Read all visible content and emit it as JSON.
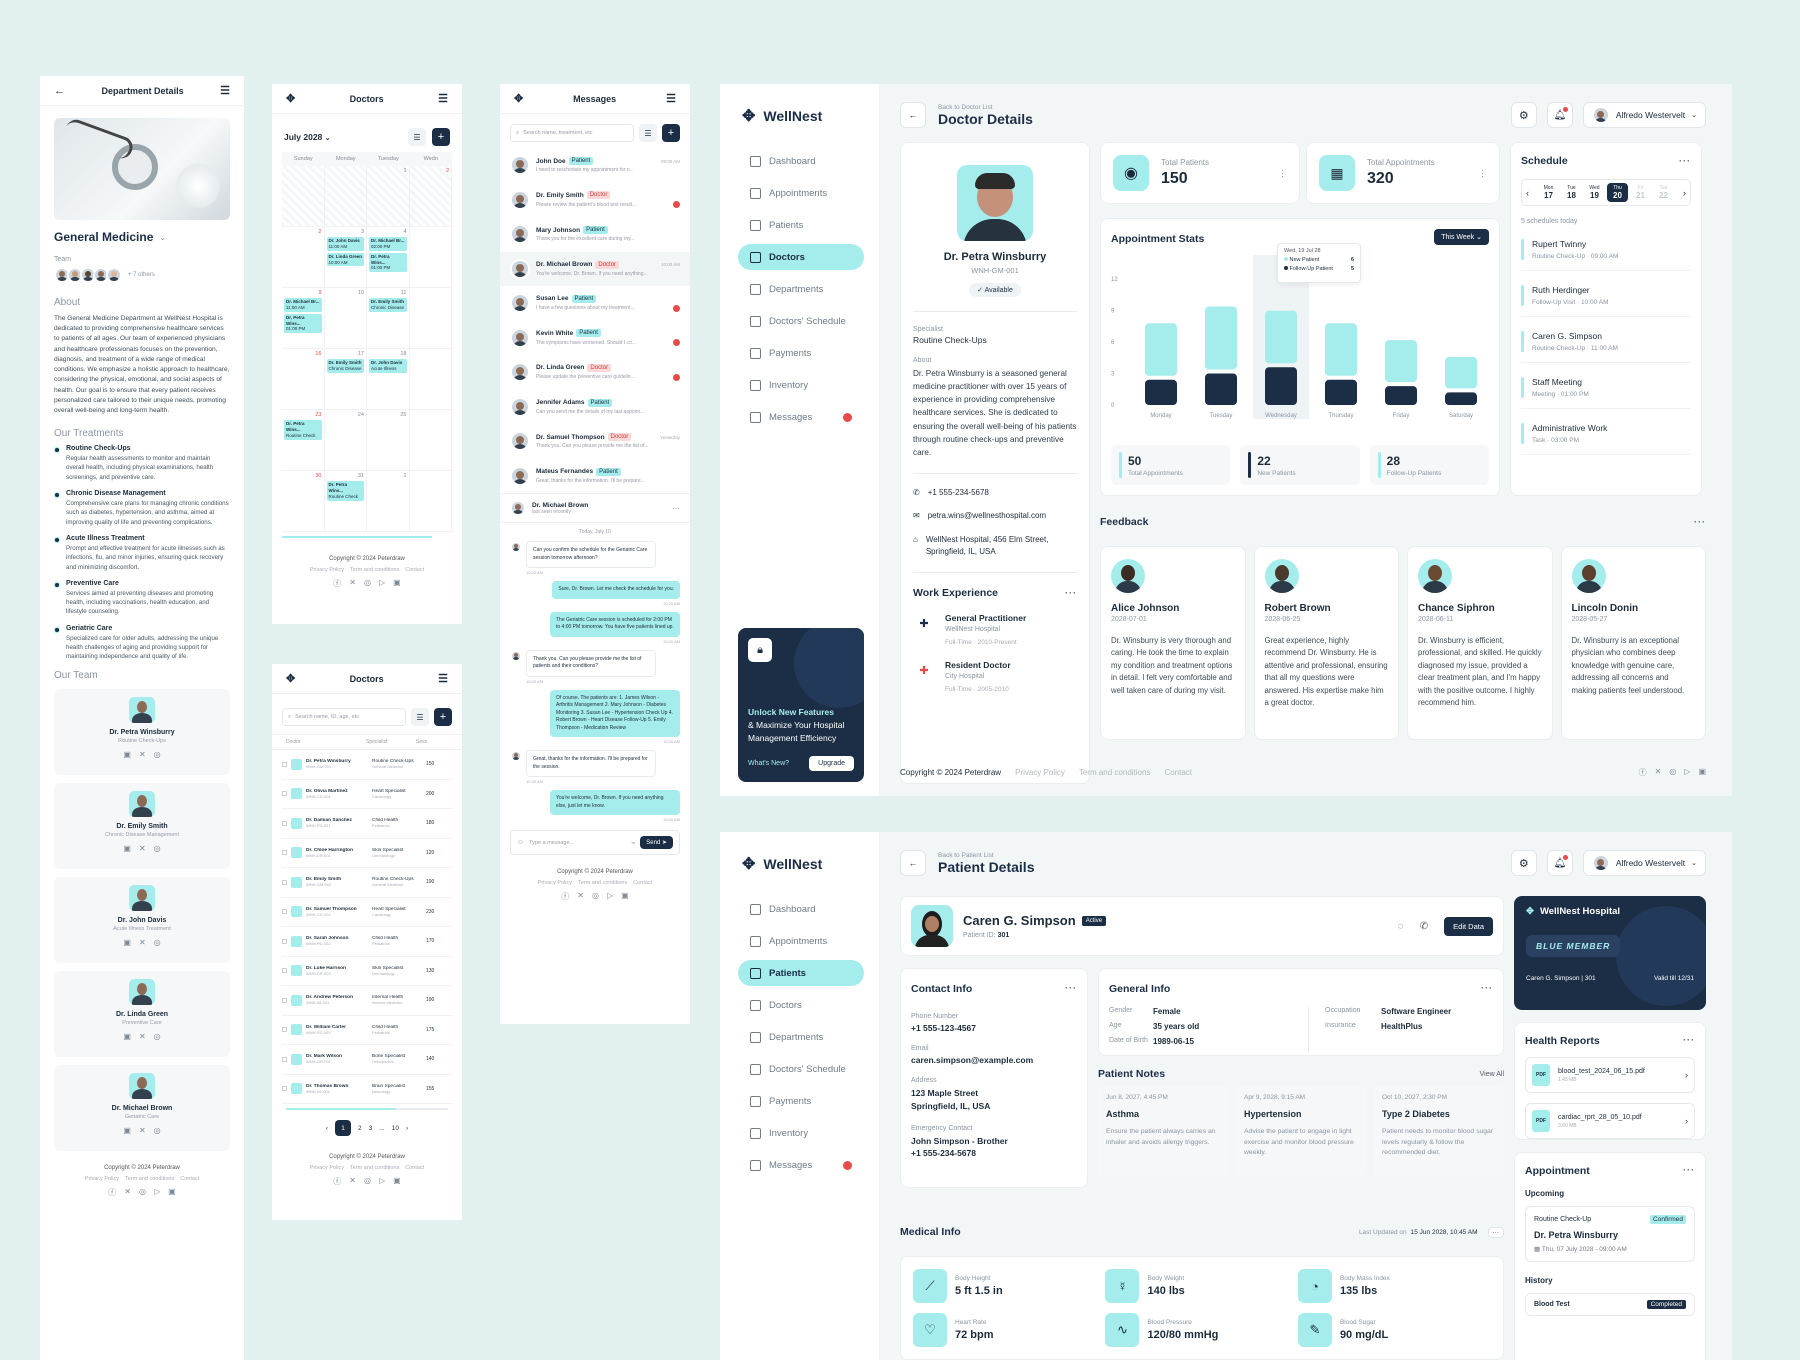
{
  "mob1": {
    "title": "Department Details",
    "dept": "General Medicine",
    "team_label": "Team",
    "team_more": "+ 7 others",
    "about_h": "About",
    "about": "The General Medicine Department at WellNest Hospital is dedicated to providing comprehensive healthcare services to patients of all ages. Our team of experienced physicians and healthcare professionals focuses on the prevention, diagnosis, and treatment of a wide range of medical conditions. We emphasize a holistic approach to healthcare, considering the physical, emotional, and social aspects of health. Our goal is to ensure that every patient receives personalized care tailored to their unique needs, promoting overall well-being and long-term health.",
    "treat_h": "Our Treatments",
    "treatments": [
      {
        "t": "Routine Check-Ups",
        "d": "Regular health assessments to monitor and maintain overall health, including physical examinations, health screenings, and preventive care."
      },
      {
        "t": "Chronic Disease Management",
        "d": "Comprehensive care plans for managing chronic conditions such as diabetes, hypertension, and asthma, aimed at improving quality of life and preventing complications."
      },
      {
        "t": "Acute Illness Treatment",
        "d": "Prompt and effective treatment for acute illnesses such as infections, flu, and minor injuries, ensuring quick recovery and minimizing discomfort."
      },
      {
        "t": "Preventive Care",
        "d": "Services aimed at preventing diseases and promoting health, including vaccinations, health education, and lifestyle counseling."
      },
      {
        "t": "Geriatric Care",
        "d": "Specialized care for older adults, addressing the unique health challenges of aging and providing support for maintaining independence and quality of life."
      }
    ],
    "team_h": "Our Team",
    "team": [
      {
        "n": "Dr. Petra Winsburry",
        "r": "Routine Check-Ups"
      },
      {
        "n": "Dr. Emily Smith",
        "r": "Chronic Disease Management"
      },
      {
        "n": "Dr. John Davis",
        "r": "Acute Illness Treatment"
      },
      {
        "n": "Dr. Linda Green",
        "r": "Preventive Care"
      },
      {
        "n": "Dr. Michael Brown",
        "r": "Geriatric Care"
      }
    ],
    "copyright": "Copyright © 2024 Peterdraw",
    "links": [
      "Privacy Policy",
      "Term and conditions",
      "Contact"
    ]
  },
  "mob2": {
    "title": "Doctors",
    "month": "July 2028",
    "days": [
      "Sunday",
      "Monday",
      "Tuesday",
      "Wedn"
    ],
    "weeks": [
      [
        "",
        "",
        " 1",
        "2"
      ],
      [
        "2",
        "3",
        "4",
        ""
      ],
      [
        "9",
        "10",
        "11",
        ""
      ],
      [
        "16",
        "17",
        "18",
        ""
      ],
      [
        "23",
        "24",
        "25",
        ""
      ],
      [
        "30",
        "31",
        "1",
        ""
      ]
    ],
    "events": [
      {
        "t": "Dr. John Davis",
        "s": "11:00 AM"
      },
      {
        "t": "Dr. Michael Br...",
        "s": "02:00 PM"
      },
      {
        "t": "Dr. Linda Green",
        "s": "10:00 AM"
      },
      {
        "t": "Dr. Petra Wins...",
        "s": "01:00 PM"
      },
      {
        "t": "Dr. Michael Br...",
        "s": "11:00 AM"
      },
      {
        "t": "Dr. Emily Smith",
        "s": "Chronic Disease"
      },
      {
        "t": "Dr. Emily Smith",
        "s": "Chronic Disease"
      },
      {
        "t": "Dr. John Davis",
        "s": "Acute Illness"
      },
      {
        "t": "Dr. Petra Wins...",
        "s": "Routine Check"
      },
      {
        "t": "Dr. Petra Wins...",
        "s": "Routine Check"
      }
    ],
    "copyright": "Copyright © 2024 Peterdraw",
    "links": [
      "Privacy Policy",
      "Term and conditions",
      "Contact"
    ]
  },
  "mob3": {
    "title": "Doctors",
    "search": "Search name, ID, age, etc",
    "cols": [
      "Doctor",
      "Specialist",
      "Sess"
    ],
    "rows": [
      [
        "Dr. Petra Winsburry",
        "WNH-GM-001",
        "Routine Check-Ups",
        "General Medicine",
        "150"
      ],
      [
        "Dr. Olivia Martinez",
        "WNH-CD-001",
        "Heart Specialist",
        "Cardiology",
        "200"
      ],
      [
        "Dr. Damian Sanchez",
        "WNH-PD-001",
        "Child Health",
        "Pediatrics",
        "180"
      ],
      [
        "Dr. Chloe Harrington",
        "WNH-DR-001",
        "Skin Specialist",
        "Dermatology",
        "120"
      ],
      [
        "Dr. Emily Smith",
        "WNH-GM-002",
        "Routine Check-Ups",
        "General Medicine",
        "190"
      ],
      [
        "Dr. Samuel Thompson",
        "WNH-CD-002",
        "Heart Specialist",
        "Cardiology",
        "230"
      ],
      [
        "Dr. Sarah Johnson",
        "WNH-PD-002",
        "Child Health",
        "Pediatrics",
        "170"
      ],
      [
        "Dr. Luke Harrison",
        "WNH-DR-002",
        "Skin Specialist",
        "Dermatology",
        "130"
      ],
      [
        "Dr. Andrew Peterson",
        "WNH-IM-001",
        "Internal Health",
        "Internal Medicine",
        "190"
      ],
      [
        "Dr. William Carter",
        "WNH-PD-003",
        "Child Health",
        "Pediatrics",
        "175"
      ],
      [
        "Dr. Mark Wilson",
        "WNH-OR-001",
        "Bone Specialist",
        "Orthopedics",
        "140"
      ],
      [
        "Dr. Thomas Brown",
        "WNH-NL-001",
        "Brain Specialist",
        "Neurology",
        "155"
      ]
    ],
    "pages": [
      "1",
      "2",
      "3",
      "...",
      "10"
    ],
    "copyright": "Copyright © 2024 Peterdraw",
    "links": [
      "Privacy Policy",
      "Term and conditions",
      "Contact"
    ]
  },
  "mob4": {
    "title": "Messages",
    "search": "Search name, treatment, etc",
    "threads": [
      {
        "n": "John Doe",
        "tag": "Patient",
        "m": "I need to reschedule my appointment for n...",
        "time": "09:00 AM",
        "red": false
      },
      {
        "n": "Dr. Emily Smith",
        "tag": "Doctor",
        "m": "Please review the patient's blood test result...",
        "time": "",
        "red": true
      },
      {
        "n": "Mary Johnson",
        "tag": "Patient",
        "m": "Thank you for the excellent care during my...",
        "time": "",
        "red": false
      },
      {
        "n": "Dr. Michael Brown",
        "tag": "Doctor",
        "m": "You're welcome, Dr. Brown. If you need anything...",
        "time": "10:00 AM",
        "red": false
      },
      {
        "n": "Susan Lee",
        "tag": "Patient",
        "m": "I have a few questions about my treatment...",
        "time": "",
        "red": true
      },
      {
        "n": "Kevin White",
        "tag": "Patient",
        "m": "The symptoms have worsened. Should I co...",
        "time": "",
        "red": true
      },
      {
        "n": "Dr. Linda Green",
        "tag": "Doctor",
        "m": "Please update the preventive care guidelin...",
        "time": "",
        "red": true
      },
      {
        "n": "Jennifer Adams",
        "tag": "Patient",
        "m": "Can you send me the details of my last appoint...",
        "time": "",
        "red": false
      },
      {
        "n": "Dr. Samuel Thompson",
        "tag": "Doctor",
        "m": "Thank you. Can you please provide me the list of...",
        "time": "Yesterday",
        "red": false
      },
      {
        "n": "Mateus Fernandes",
        "tag": "Patient",
        "m": "Great, thanks for the information. I'll be prepare...",
        "time": "",
        "red": false
      }
    ],
    "chat_name": "Dr. Michael Brown",
    "chat_status": "last seen recently",
    "day": "Today, July 10",
    "msgs": [
      {
        "me": false,
        "t": "Can you confirm the schedule for the Geriatric Care session tomorrow afternoon?",
        "time": "10:00 AM"
      },
      {
        "me": true,
        "t": "Sure, Dr. Brown. Let me check the schedule for you.",
        "time": "10:20 AM"
      },
      {
        "me": true,
        "t": "The Geriatric Care session is scheduled for 2:00 PM to 4:00 PM tomorrow. You have five patients lined up.",
        "time": "10:20 AM"
      },
      {
        "me": false,
        "t": "Thank you. Can you please provide me the list of patients and their conditions?",
        "time": "10:25 AM"
      },
      {
        "me": true,
        "t": "Of course. The patients are: 1. James Wilson - Arthritis Management 2. Mary Johnson - Diabetes Monitoring 3. Susan Lee - Hypertension Check Up 4. Robert Brown - Heart Disease Follow-Up 5. Emily Thompson - Medication Review",
        "time": "10:30 AM"
      },
      {
        "me": false,
        "t": "Great, thanks for the information. I'll be prepared for the session.",
        "time": "10:35 AM"
      },
      {
        "me": true,
        "t": "You're welcome, Dr. Brown. If you need anything else, just let me know.",
        "time": "10:40 AM"
      }
    ],
    "input": "Type a message...",
    "send": "Send",
    "copyright": "Copyright © 2024 Peterdraw",
    "links": [
      "Privacy Policy",
      "Term and conditions",
      "Contact"
    ]
  },
  "brand": "WellNest",
  "nav": [
    "Dashboard",
    "Appointments",
    "Patients",
    "Doctors",
    "Departments",
    "Doctors' Schedule",
    "Payments",
    "Inventory",
    "Messages"
  ],
  "user": "Alfredo Westervelt",
  "promo": {
    "l1": "Unlock New Features",
    "l2": "& Maximize Your Hospital Management Efficiency",
    "whats": "What's New?",
    "upgrade": "Upgrade"
  },
  "doc": {
    "back": "Back to Doctor List",
    "title": "Doctor Details",
    "name": "Dr. Petra Winsburry",
    "id": "WNH-GM-001",
    "status": "Available",
    "spec_l": "Specialist",
    "spec": "Routine Check-Ups",
    "about_l": "About",
    "about": "Dr. Petra Winsburry is a seasoned general medicine practitioner with over 15 years of experience in providing comprehensive healthcare services. She is dedicated to ensuring the overall well-being of his patients through routine check-ups and preventive care.",
    "phone": "+1 555-234-5678",
    "email": "petra.wins@wellnesthospital.com",
    "addr": "WellNest Hospital, 456 Elm Street, Springfield, IL, USA",
    "work_h": "Work Experience",
    "work": [
      {
        "t": "General Practitioner",
        "o": "WellNest Hospital",
        "p": "Full-Time",
        "y": "2010-Present"
      },
      {
        "t": "Resident Doctor",
        "o": "City Hospital",
        "p": "Full-Time",
        "y": "2005-2010"
      }
    ],
    "tp_l": "Total Patients",
    "tp": "150",
    "ta_l": "Total Appointments",
    "ta": "320",
    "stats_h": "Appointment Stats",
    "week": "This Week",
    "tip_d": "Wed, 19 Jul 28",
    "tip_np": "New Patient",
    "tip_np_v": "6",
    "tip_fu": "Follow-Up Patient",
    "tip_fu_v": "5",
    "sum": [
      {
        "v": "50",
        "l": "Total Appointments"
      },
      {
        "v": "22",
        "l": "New Patients"
      },
      {
        "v": "28",
        "l": "Follow-Up Patients"
      }
    ],
    "sched_h": "Schedule",
    "sched_days": [
      [
        "Mon",
        "17"
      ],
      [
        "Tue",
        "18"
      ],
      [
        "Wed",
        "19"
      ],
      [
        "Thu",
        "20"
      ],
      [
        "Fri",
        "21"
      ],
      [
        "Sat",
        "22"
      ]
    ],
    "sched_count": "5 schedules today",
    "sched": [
      {
        "n": "Rupert Twinny",
        "t": "Routine Check-Up",
        "h": "09:00 AM"
      },
      {
        "n": "Ruth Herdinger",
        "t": "Follow-Up Visit",
        "h": "10:00 AM"
      },
      {
        "n": "Caren G. Simpson",
        "t": "Routine Check-Up",
        "h": "11:00 AM"
      },
      {
        "n": "Staff Meeting",
        "t": "Meeting",
        "h": "01:00 PM"
      },
      {
        "n": "Administrative Work",
        "t": "Task",
        "h": "03:00 PM"
      }
    ],
    "fb_h": "Feedback",
    "fb": [
      {
        "n": "Alice Johnson",
        "d": "2028-07-01",
        "t": "Dr. Winsburry is very thorough and caring. He took the time to explain my condition and treatment options in detail. I felt very comfortable and well taken care of during my visit."
      },
      {
        "n": "Robert Brown",
        "d": "2028-06-25",
        "t": "Great experience, highly recommend Dr. Winsburry. He is attentive and professional, ensuring that all my questions were answered. His expertise make him a great doctor."
      },
      {
        "n": "Chance Siphron",
        "d": "2028-06-11",
        "t": "Dr. Winsburry is efficient, professional, and skilled. He quickly diagnosed my issue, provided a clear treatment plan, and I'm happy with the positive outcome. I highly recommend him."
      },
      {
        "n": "Lincoln Donin",
        "d": "2028-05-27",
        "t": "Dr. Winsburry is an exceptional physician who combines deep knowledge with genuine care, addressing all concerns and making patients feel understood."
      }
    ],
    "copyright": "Copyright © 2024 Peterdraw",
    "links": [
      "Privacy Policy",
      "Term and conditions",
      "Contact"
    ]
  },
  "chart_data": {
    "type": "bar",
    "categories": [
      "Monday",
      "Tuesday",
      "Wednesday",
      "Thursday",
      "Friday",
      "Saturday"
    ],
    "series": [
      {
        "name": "New Patient",
        "values": [
          4,
          5,
          6,
          4,
          3,
          2
        ]
      },
      {
        "name": "Follow-Up Patient",
        "values": [
          5,
          6,
          5,
          5,
          4,
          3
        ]
      }
    ],
    "ylim": [
      0,
      12
    ],
    "yticks": [
      "12",
      "9",
      "6",
      "3",
      "0"
    ],
    "stacked": true
  },
  "pat": {
    "back": "Back to Patient List",
    "title": "Patient Details",
    "name": "Caren G. Simpson",
    "status": "Active",
    "pid_l": "Patient ID:",
    "pid": "301",
    "edit": "Edit Data",
    "contact_h": "Contact Info",
    "phone_l": "Phone Number",
    "phone": "+1 555-123-4567",
    "email_l": "Email",
    "email": "caren.simpson@example.com",
    "addr_l": "Address",
    "addr1": "123 Maple Street",
    "addr2": "Springfield, IL, USA",
    "emerg_l": "Emergency Contact",
    "emerg1": "John Simpson - Brother",
    "emerg2": "+1 555-234-5678",
    "gen_h": "General Info",
    "gen": [
      [
        "Gender",
        "Female"
      ],
      [
        "Age",
        "35 years old"
      ],
      [
        "Date of Birth",
        "1989-06-15"
      ]
    ],
    "gen2": [
      [
        "Occupation",
        "Software Engineer"
      ],
      [
        "Insurance",
        "HealthPlus"
      ]
    ],
    "notes_h": "Patient Notes",
    "view_all": "View All",
    "notes": [
      {
        "d": "Jun 8, 2027, 4:45 PM",
        "t": "Asthma",
        "x": "Ensure the patient always carries an inhaler and avoids allergy triggers."
      },
      {
        "d": "Apr 9, 2028, 9:15 AM",
        "t": "Hypertension",
        "x": "Advise the patient to engage in light exercise and monitor blood pressure weekly."
      },
      {
        "d": "Oct 10, 2027, 2:30 PM",
        "t": "Type 2 Diabetes",
        "x": "Patient needs to monitor blood sugar levels regularly & follow the recommended diet."
      }
    ],
    "card_title": "WellNest Hospital",
    "card_tier": "BLUE MEMBER",
    "card_holder": "Caren G. Simpson | 301",
    "card_valid": "Valid till 12/31",
    "reports_h": "Health Reports",
    "reports": [
      {
        "f": "blood_test_2024_06_15.pdf",
        "s": "1.45 MB"
      },
      {
        "f": "cardiac_rprt_28_05_10.pdf",
        "s": "3.60 MB"
      }
    ],
    "appt_h": "Appointment",
    "upcoming": "Upcoming",
    "appt_type": "Routine Check-Up",
    "appt_status": "Confirmed",
    "appt_doc": "Dr. Petra Winsburry",
    "appt_time": "Thu, 07 July 2028 - 09:00 AM",
    "history": "History",
    "hist_type": "Blood Test",
    "hist_status": "Completed",
    "med_h": "Medical Info",
    "updated_l": "Last Updated on",
    "updated": "15 Jun 2028, 10:45 AM",
    "med": [
      [
        "Body Height",
        "5 ft 1.5 in"
      ],
      [
        "Body Weight",
        "140 lbs"
      ],
      [
        "Body Mass Index",
        "135 lbs"
      ],
      [
        "Heart Rate",
        "72 bpm"
      ],
      [
        "Blood Pressure",
        "120/80 mmHg"
      ],
      [
        "Blood Sugar",
        "90 mg/dL"
      ]
    ]
  },
  "colors": {
    "accent": "#a5ecec",
    "navy": "#1b2e45",
    "bg": "#e3f0f0"
  }
}
